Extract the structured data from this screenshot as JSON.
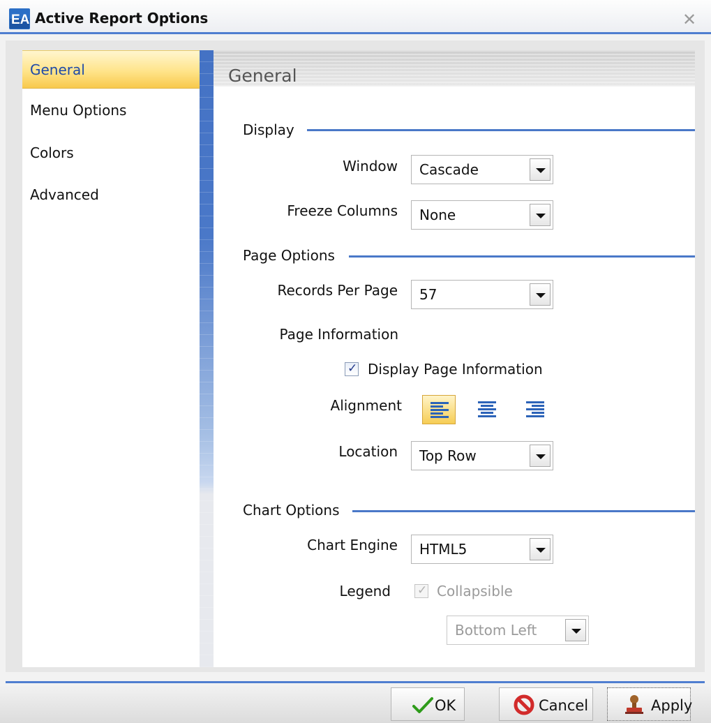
{
  "window": {
    "title": "Active Report Options",
    "logo": "EA"
  },
  "nav": {
    "items": [
      {
        "label": "General"
      },
      {
        "label": "Menu Options"
      },
      {
        "label": "Colors"
      },
      {
        "label": "Advanced"
      }
    ],
    "selected": "General"
  },
  "content": {
    "title": "General",
    "display": {
      "heading": "Display",
      "window_label": "Window",
      "window_value": "Cascade",
      "freeze_label": "Freeze Columns",
      "freeze_value": "None"
    },
    "page_options": {
      "heading": "Page Options",
      "records_label": "Records Per Page",
      "records_value": "57",
      "page_info_label": "Page Information",
      "display_page_info_label": "Display Page Information",
      "display_page_info_checked": true,
      "alignment_label": "Alignment",
      "alignment_selected": "left",
      "location_label": "Location",
      "location_value": "Top Row"
    },
    "chart_options": {
      "heading": "Chart Options",
      "engine_label": "Chart Engine",
      "engine_value": "HTML5",
      "legend_label": "Legend",
      "collapsible_label": "Collapsible",
      "collapsible_checked": true,
      "collapsible_enabled": false,
      "legend_position_value": "Bottom Left"
    }
  },
  "footer": {
    "ok_label": "OK",
    "cancel_label": "Cancel",
    "apply_label": "Apply"
  },
  "colors": {
    "accent_blue": "#4a78c8",
    "selected_nav": "#f8c94c",
    "ok_icon": "#2e9b1a",
    "cancel_icon": "#d22b2b"
  },
  "icons": [
    "app-logo-icon",
    "close-icon",
    "dropdown-arrow-icon",
    "checkbox-check-icon",
    "align-left-icon",
    "align-center-icon",
    "align-right-icon",
    "ok-check-icon",
    "cancel-icon",
    "apply-stamp-icon"
  ]
}
